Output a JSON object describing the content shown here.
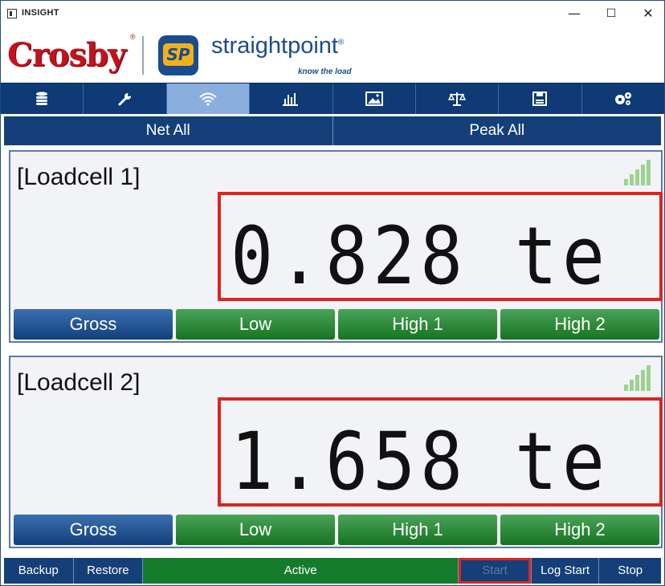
{
  "window": {
    "title": "INSIGHT",
    "controls": {
      "minimize": "—",
      "maximize": "☐",
      "close": "✕"
    }
  },
  "branding": {
    "left_logo": "Crosby",
    "left_logo_mark": "®",
    "sp_badge": "SP",
    "right_logo": "straightpoint",
    "right_logo_mark": "®",
    "tagline": "know the load"
  },
  "navbar": {
    "items": [
      {
        "icon": "database-icon",
        "glyph": "≣"
      },
      {
        "icon": "wrench-icon",
        "glyph": "🔧"
      },
      {
        "icon": "wifi-icon",
        "glyph": "((•))",
        "active": true
      },
      {
        "icon": "bar-chart-icon",
        "glyph": "▥"
      },
      {
        "icon": "image-icon",
        "glyph": "▨"
      },
      {
        "icon": "scale-icon",
        "glyph": "⚖"
      },
      {
        "icon": "save-icon",
        "glyph": "▤"
      },
      {
        "icon": "gears-icon",
        "glyph": "⚙"
      }
    ]
  },
  "actions": {
    "net_all": "Net All",
    "peak_all": "Peak All"
  },
  "loadcells": [
    {
      "name": "[Loadcell 1]",
      "reading": "0.828 te",
      "buttons": {
        "gross": "Gross",
        "low": "Low",
        "high1": "High 1",
        "high2": "High 2"
      }
    },
    {
      "name": "[Loadcell 2]",
      "reading": "1.658 te",
      "buttons": {
        "gross": "Gross",
        "low": "Low",
        "high1": "High 1",
        "high2": "High 2"
      }
    }
  ],
  "statusbar": {
    "backup": "Backup",
    "restore": "Restore",
    "status": "Active",
    "start": "Start",
    "log_start": "Log Start",
    "stop": "Stop"
  },
  "colors": {
    "nav_bg": "#0e3a75",
    "nav_active": "#8aaede",
    "highlight_box": "#e0231f",
    "green_button": "#16741f",
    "blue_button": "#123f7c",
    "crosby_red": "#c2121e",
    "sp_gold": "#f2b11a"
  }
}
